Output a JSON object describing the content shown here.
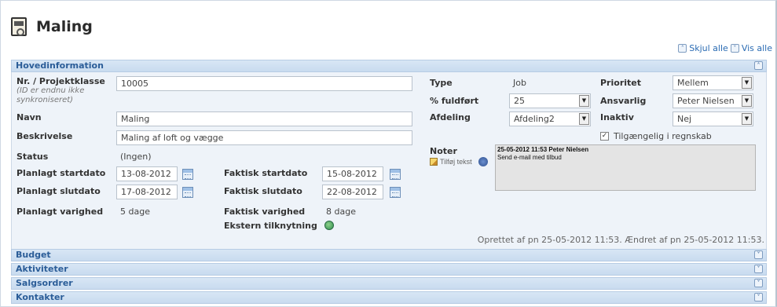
{
  "page": {
    "title": "Maling"
  },
  "toggle": {
    "collapse_all": "Skjul alle",
    "expand_all": "Vis alle"
  },
  "sections": {
    "main": "Hovedinformation",
    "budget": "Budget",
    "activities": "Aktiviteter",
    "sales_orders": "Salgsordrer",
    "contacts": "Kontakter"
  },
  "form": {
    "project_no_label": "Nr. / Projektklasse",
    "project_no_note": "(ID er endnu ikke synkroniseret)",
    "project_no_value": "10005",
    "name_label": "Navn",
    "name_value": "Maling",
    "description_label": "Beskrivelse",
    "description_value": "Maling af loft og vægge",
    "status_label": "Status",
    "status_value": "(Ingen)",
    "planned_start_label": "Planlagt startdato",
    "planned_start_value": "13-08-2012",
    "planned_end_label": "Planlagt slutdato",
    "planned_end_value": "17-08-2012",
    "planned_duration_label": "Planlagt varighed",
    "planned_duration_value": "5 dage",
    "actual_start_label": "Faktisk startdato",
    "actual_start_value": "15-08-2012",
    "actual_end_label": "Faktisk slutdato",
    "actual_end_value": "22-08-2012",
    "actual_duration_label": "Faktisk varighed",
    "actual_duration_value": "8 dage",
    "external_link_label": "Ekstern tilknytning",
    "type_label": "Type",
    "type_value": "Job",
    "percent_label": "% fuldført",
    "percent_value": "25",
    "department_label": "Afdeling",
    "department_value": "Afdeling2",
    "priority_label": "Prioritet",
    "priority_value": "Mellem",
    "responsible_label": "Ansvarlig",
    "responsible_value": "Peter Nielsen",
    "inactive_label": "Inaktiv",
    "inactive_value": "Nej",
    "accounting_label": "Tilgængelig i regnskab",
    "accounting_checked": true,
    "notes_label": "Noter",
    "add_text_label": "Tilføj tekst",
    "notes_line1": "25-05-2012 11:53 Peter Nielsen",
    "notes_line2": "Send e-mail med tilbud"
  },
  "footer": {
    "created_changed": "Oprettet af pn 25-05-2012 11:53. Ændret af pn 25-05-2012 11:53."
  },
  "colors": {
    "section_bar": "#c8dbef",
    "section_text": "#2b5d98",
    "panel_bg": "#eef3f9",
    "link": "#2a6bb3"
  },
  "icons": {
    "title": "painting-job-icon",
    "calendar": "calendar-icon",
    "collapse": "collapse-icon",
    "expand": "expand-icon",
    "external_link": "globe-link-icon",
    "add_text": "pencil-icon",
    "spell": "spellcheck-icon"
  }
}
